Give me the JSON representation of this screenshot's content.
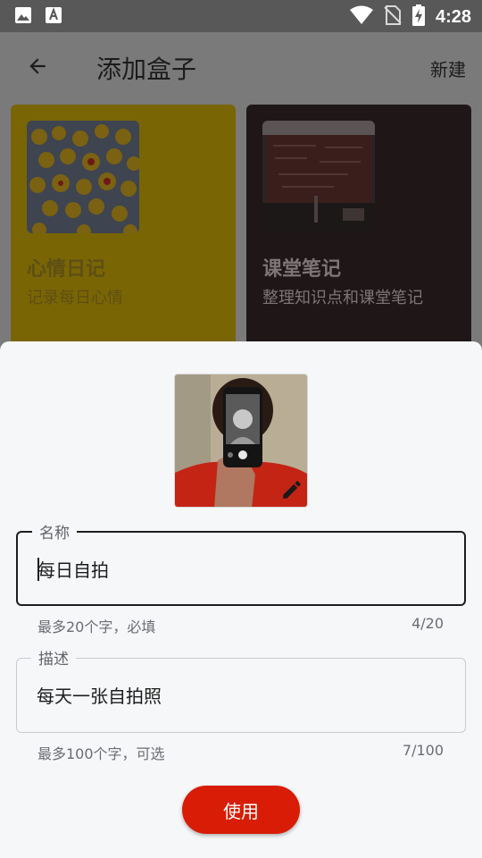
{
  "status_bar": {
    "time": "4:28",
    "left_icons": [
      "image-icon",
      "text-icon"
    ],
    "right_icons": [
      "wifi-icon",
      "no-sim-icon",
      "battery-charging-icon"
    ]
  },
  "app_bar": {
    "back_icon": "arrow-back-icon",
    "title": "添加盒子",
    "action_label": "新建"
  },
  "cards": [
    {
      "title": "心情日记",
      "subtitle": "记录每日心情",
      "image": "emoji-faces-photo",
      "color": "#7a6505"
    },
    {
      "title": "课堂笔记",
      "subtitle": "整理知识点和课堂笔记",
      "image": "classroom-blackboard-photo",
      "color": "#1f1717"
    }
  ],
  "sheet": {
    "cover_image": "selfie-phone-photo",
    "cover_edit_icon": "pencil-icon",
    "name_field": {
      "label": "名称",
      "value": "每日自拍",
      "helper": "最多20个字，必填",
      "counter": "4/20"
    },
    "desc_field": {
      "label": "描述",
      "value": "每天一张自拍照",
      "helper": "最多100个字，可选",
      "counter": "7/100"
    },
    "submit_label": "使用"
  },
  "colors": {
    "accent": "#d81c05",
    "scrim": "#7a7a7a",
    "sheet_bg": "#f6f7f9"
  }
}
